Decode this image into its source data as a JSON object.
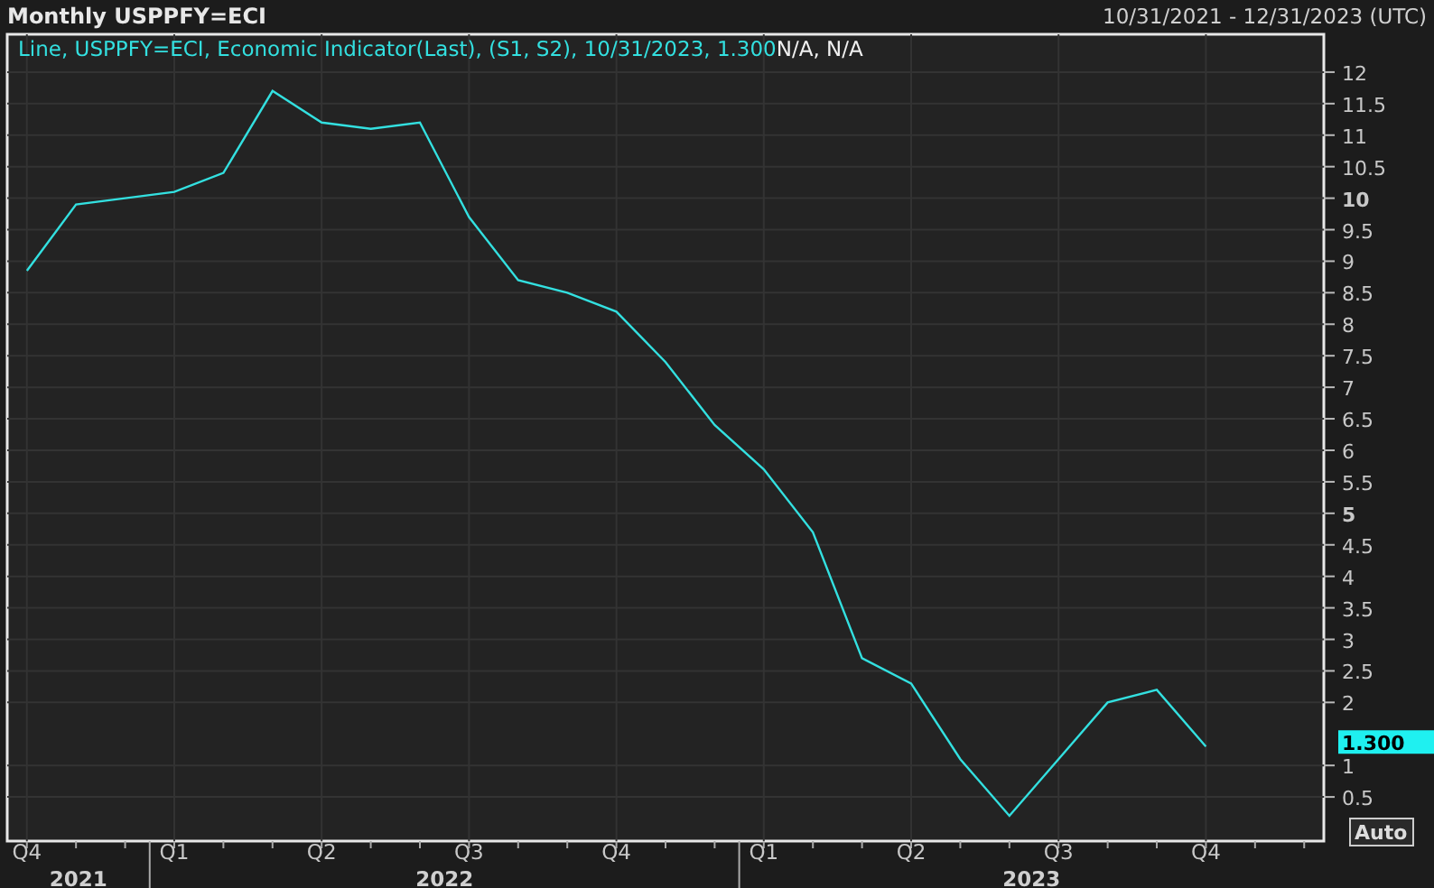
{
  "header": {
    "title": "Monthly USPPFY=ECI",
    "date_range": "10/31/2021 - 12/31/2023 (UTC)"
  },
  "legend": {
    "series_text": "Line, USPPFY=ECI, Economic Indicator(Last), (S1, S2), 10/31/2023, 1.300",
    "extra_text": "N/A, N/A"
  },
  "last_value_badge": "1.300",
  "auto_button": "Auto",
  "chart_data": {
    "type": "line",
    "categories": [
      "Q4",
      null,
      null,
      "Q1",
      null,
      null,
      "Q2",
      null,
      null,
      "Q3",
      null,
      null,
      "Q4",
      null,
      null,
      "Q1",
      null,
      null,
      "Q2",
      null,
      null,
      "Q3",
      null,
      null,
      "Q4",
      null,
      null
    ],
    "series": [
      {
        "color": "#33e0e0",
        "values": [
          8.85,
          9.9,
          10.0,
          10.1,
          10.4,
          11.7,
          11.2,
          11.1,
          11.2,
          9.7,
          8.7,
          8.5,
          8.2,
          7.4,
          6.4,
          5.7,
          4.7,
          2.7,
          2.3,
          1.1,
          0.2,
          1.1,
          2.0,
          2.2,
          1.3,
          null,
          null
        ]
      }
    ],
    "grid": true,
    "ylim": [
      -0.2,
      12.6
    ],
    "yticks": [
      0.5,
      1,
      2,
      2.5,
      3,
      3.5,
      4,
      4.5,
      5,
      5.5,
      6,
      6.5,
      7,
      7.5,
      8,
      8.5,
      9,
      9.5,
      10,
      10.5,
      11,
      11.5,
      12
    ]
  },
  "year_labels": [
    "2021",
    "2022",
    "2023"
  ]
}
